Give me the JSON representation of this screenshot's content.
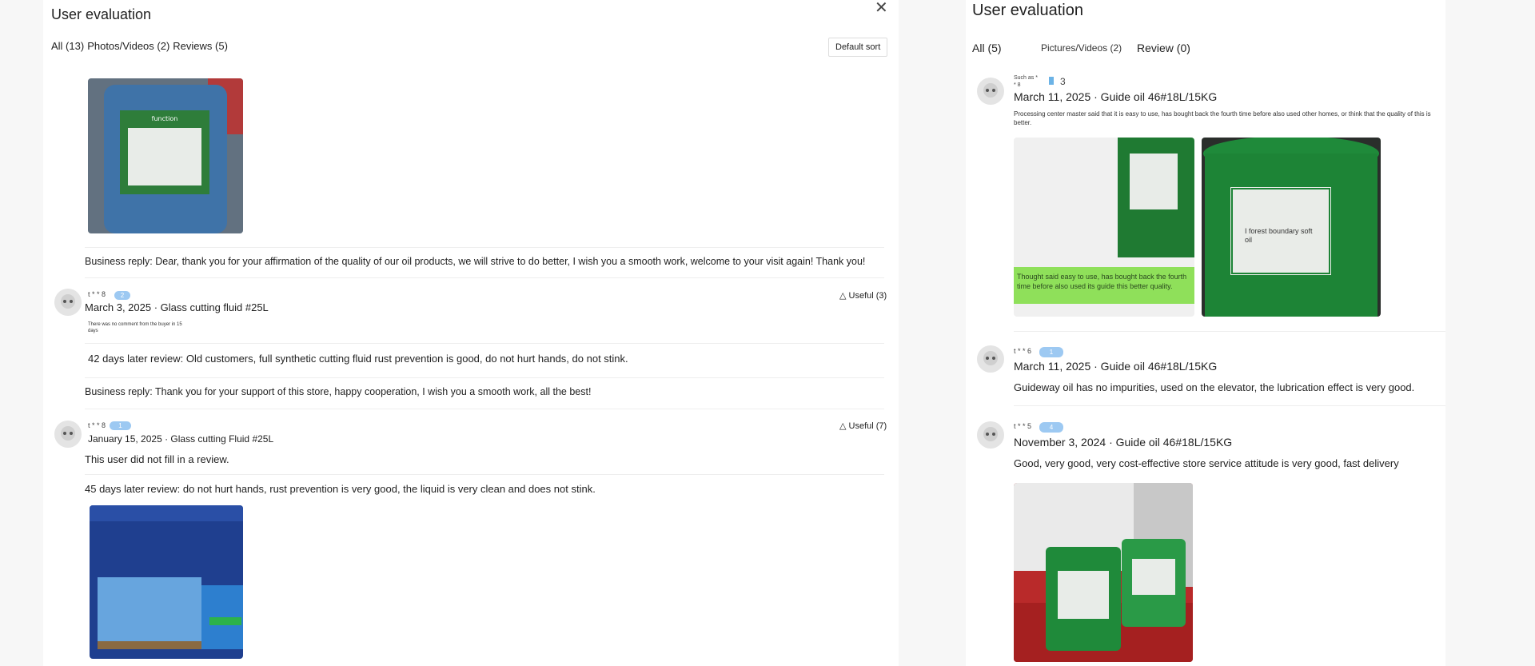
{
  "left": {
    "title": "User evaluation",
    "filters": {
      "all": "All (13)",
      "photos": "Photos/Videos (2)",
      "reviews": "Reviews (5)"
    },
    "sort_label": "Default sort",
    "reply1": "Business reply: Dear, thank you for your affirmation of the quality of our oil products, we will strive to do better, I wish you a smooth work, welcome to your visit again! Thank you!",
    "review2": {
      "user": "t * * 8",
      "badge": "2",
      "date_product": "March 3, 2025 · Glass cutting fluid #25L",
      "useful": "Useful (3)",
      "note": "There was no comment from the buyer in 15 days",
      "later": "42 days later review: Old customers, full synthetic cutting fluid rust prevention is good, do not hurt hands, do not stink.",
      "reply": "Business reply: Thank you for your support of this store, happy cooperation, I wish you a smooth work, all the best!"
    },
    "review3": {
      "user": "t * * 8",
      "badge": "1",
      "date_product": "January 15, 2025 · Glass cutting Fluid #25L",
      "useful": "Useful (7)",
      "text": "This user did not fill in a review.",
      "later": "45 days later review: do not hurt hands, rust prevention is very good, the liquid is very clean and does not stink."
    }
  },
  "right": {
    "title": "User evaluation",
    "tabs": {
      "all": "All (5)",
      "pictures": "Pictures/Videos (2)",
      "review": "Review (0)"
    },
    "r1": {
      "user": "Such as * * 8",
      "level": "3",
      "date_product": "March 11, 2025 · Guide oil 46#18L/15KG",
      "text": "Processing center master said that it is easy to use, has bought back the fourth time before also used other homes, or think that the quality of this is better.",
      "overlay": "Thought said easy to use, has bought back the fourth time before also used its guide this better quality.",
      "label": "I forest boundary soft oil"
    },
    "r2": {
      "user": "t * * 6",
      "badge": "1",
      "date_product": "March 11, 2025 · Guide oil 46#18L/15KG",
      "text": "Guideway oil has no impurities, used on the elevator, the lubrication effect is very good."
    },
    "r3": {
      "user": "t * * 5",
      "badge": "4",
      "date_product": "November 3, 2024 · Guide oil 46#18L/15KG",
      "text": "Good, very good, very cost-effective store service attitude is very good, fast delivery"
    }
  }
}
